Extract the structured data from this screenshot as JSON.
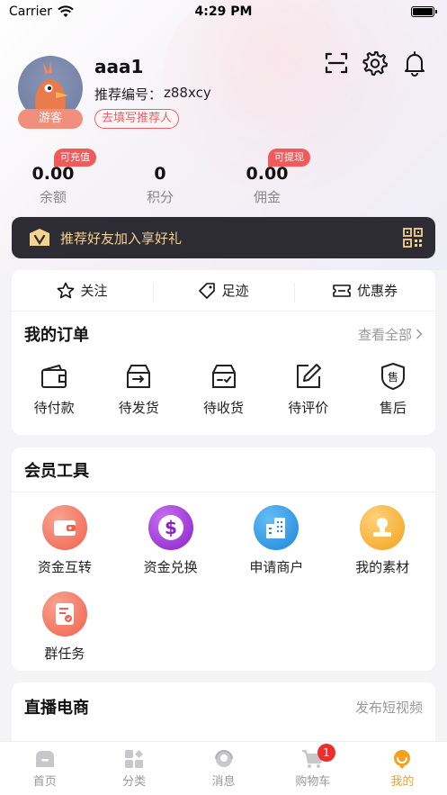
{
  "status_bar": {
    "carrier": "Carrier",
    "time": "4:29 PM"
  },
  "profile": {
    "username": "aaa1",
    "ref_label": "推荐编号：",
    "ref_code": "z88xcy",
    "guest_badge": "游客",
    "ref_button": "去填写推荐人"
  },
  "stats": [
    {
      "value": "0.00",
      "label": "余额",
      "tag": "可充值"
    },
    {
      "value": "0",
      "label": "积分"
    },
    {
      "value": "0.00",
      "label": "佣金",
      "tag": "可提现"
    }
  ],
  "invite": {
    "text": "推荐好友加入享好礼"
  },
  "quick": [
    {
      "label": "关注",
      "icon": "star-icon"
    },
    {
      "label": "足迹",
      "icon": "tag-icon"
    },
    {
      "label": "优惠券",
      "icon": "coupon-icon"
    }
  ],
  "orders": {
    "title": "我的订单",
    "view_all": "查看全部",
    "items": [
      {
        "label": "待付款",
        "icon": "wallet-icon"
      },
      {
        "label": "待发货",
        "icon": "box-out-icon"
      },
      {
        "label": "待收货",
        "icon": "box-check-icon"
      },
      {
        "label": "待评价",
        "icon": "edit-icon"
      },
      {
        "label": "售后",
        "icon": "after-sale-icon"
      }
    ]
  },
  "tools": {
    "title": "会员工具",
    "items": [
      {
        "label": "资金互转",
        "icon": "wallet-transfer-icon",
        "color": "#f26a5a"
      },
      {
        "label": "资金兑换",
        "icon": "dollar-icon",
        "color": "#9b2fd8"
      },
      {
        "label": "申请商户",
        "icon": "building-icon",
        "color": "#2f8fe0"
      },
      {
        "label": "我的素材",
        "icon": "stamp-icon",
        "color": "#f5a826"
      },
      {
        "label": "群任务",
        "icon": "task-icon",
        "color": "#f26a5a"
      }
    ]
  },
  "live": {
    "title": "直播电商",
    "link": "发布短视频"
  },
  "tabbar": {
    "items": [
      {
        "label": "首页",
        "icon": "home-icon"
      },
      {
        "label": "分类",
        "icon": "category-icon"
      },
      {
        "label": "消息",
        "icon": "message-icon"
      },
      {
        "label": "购物车",
        "icon": "cart-icon",
        "badge": "1"
      },
      {
        "label": "我的",
        "icon": "profile-icon",
        "active": true
      }
    ]
  },
  "colors": {
    "accent": "#f4a11f",
    "red": "#f05a5a",
    "invite_bg": "#2d2b33",
    "invite_text": "#f4d38f"
  }
}
